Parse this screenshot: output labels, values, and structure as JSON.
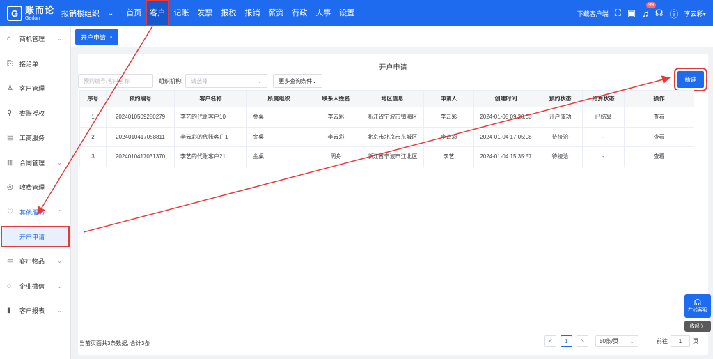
{
  "brand": {
    "name_cn": "账而论",
    "name_en": "Gerlun",
    "logo_mark": "G"
  },
  "org": {
    "label": "报销根组织",
    "caret": "⌄"
  },
  "nav": [
    "首页",
    "客户",
    "记账",
    "发票",
    "报税",
    "报销",
    "薪资",
    "行政",
    "人事",
    "设置"
  ],
  "top_right": {
    "download": "下载客户端",
    "badge": "99",
    "user": "李云彩▾"
  },
  "sidebar": {
    "items": [
      {
        "label": "商机管理",
        "icon": "⌂",
        "caret": "⌄"
      },
      {
        "label": "接洽单",
        "icon": "⎘",
        "caret": ""
      },
      {
        "label": "客户管理",
        "icon": "♙",
        "caret": ""
      },
      {
        "label": "查账授权",
        "icon": "⚲",
        "caret": ""
      },
      {
        "label": "工商服务",
        "icon": "▤",
        "caret": ""
      },
      {
        "label": "合同管理",
        "icon": "▥",
        "caret": "⌄"
      },
      {
        "label": "收费管理",
        "icon": "◎",
        "caret": ""
      },
      {
        "label": "其他服务",
        "icon": "♡",
        "caret": "⌃"
      }
    ],
    "sub_item": "开户申请",
    "items_after": [
      {
        "label": "客户物品",
        "icon": "▭",
        "caret": "⌄"
      },
      {
        "label": "企业微信",
        "icon": "◌",
        "caret": "⌄"
      },
      {
        "label": "客户报表",
        "icon": "▮",
        "caret": "⌄"
      }
    ]
  },
  "tab": {
    "label": "开户申请",
    "close": "×"
  },
  "panel": {
    "title": "开户申请",
    "search_placeholder": "预约编号/客户名称",
    "org_label": "组织机构:",
    "org_placeholder": "请选择",
    "more_filters": "更多查询条件⌄",
    "new_button": "新建"
  },
  "table": {
    "headers": [
      "序号",
      "预约编号",
      "客户名称",
      "所属组织",
      "联系人姓名",
      "地区信息",
      "申请人",
      "创建时间",
      "预约状态",
      "结算状态",
      "操作"
    ],
    "rows": [
      [
        "1",
        "2024010509280279",
        "李艺的代账客户10",
        "金桌",
        "李云彩",
        "浙江省宁波市镇海区",
        "李云彩",
        "2024-01-05 09:28:03",
        "开户成功",
        "已结算",
        "查看"
      ],
      [
        "2",
        "2024010417058811",
        "李云彩的代账客户1",
        "金桌",
        "李云彩",
        "北京市北京市东城区",
        "李云彩",
        "2024-01-04 17:05:08",
        "待接洽",
        "-",
        "查看"
      ],
      [
        "3",
        "2024010417031370",
        "李艺的代账客户21",
        "金桌",
        "周舟",
        "浙江省宁波市江北区",
        "李艺",
        "2024-01-04 15:35:57",
        "待接洽",
        "-",
        "查看"
      ]
    ]
  },
  "footer": {
    "summary": "当前页面共3条数据, 合计3条",
    "prev": "<",
    "page": "1",
    "next": ">",
    "page_size": "50条/页",
    "goto_label": "前往",
    "goto_value": "1",
    "page_unit": "页"
  },
  "float": {
    "service": "在线客服",
    "collapse": "收起 〉"
  },
  "colors": {
    "primary": "#1e6bf0",
    "annotation": "#e23b3b"
  }
}
